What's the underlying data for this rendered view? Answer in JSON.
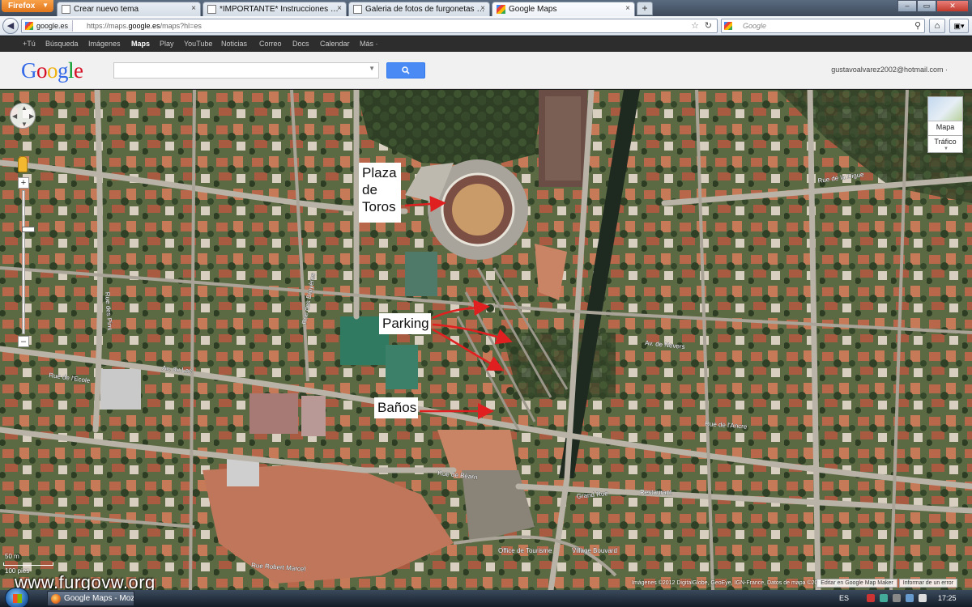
{
  "browser": {
    "menu_label": "Firefox",
    "tabs": [
      {
        "label": "Crear nuevo tema",
        "active": false
      },
      {
        "label": "*IMPORTANTE* Instrucciones para a...",
        "active": false
      },
      {
        "label": "Galeria de fotos de furgonetas campe...",
        "active": false
      },
      {
        "label": "Google Maps",
        "active": true
      }
    ],
    "new_tab": "+",
    "identity": "google.es",
    "url_prefix": "https://maps.",
    "url_domain": "google.es",
    "url_suffix": "/maps?hl=es",
    "search_placeholder": "Google"
  },
  "google_bar": {
    "items": [
      "+Tú",
      "Búsqueda",
      "Imágenes",
      "Maps",
      "Play",
      "YouTube",
      "Noticias",
      "Correo",
      "Docs",
      "Calendar",
      "Más ·"
    ],
    "selected": "Maps"
  },
  "header": {
    "logo_letters": [
      "G",
      "o",
      "o",
      "g",
      "l",
      "e"
    ],
    "search_value": "",
    "search_button_icon": "magnifier-icon",
    "user_email": "gustavoalvarez2002@hotmail.com ·"
  },
  "map": {
    "type_label": "Mapa",
    "traffic_label": "Tráfico",
    "annotations": {
      "plaza": [
        "Plaza",
        "de",
        "Toros"
      ],
      "parking": "Parking",
      "banos": "Baños"
    },
    "annotation_arrow_color": "#e02020",
    "street_labels": [
      "Rue de l'Ecole",
      "Av. du Lac",
      "Rue Robert Marcel",
      "Grand Rue",
      "Rue de l'Ancre",
      "Av. de Nevers",
      "Rue des Bruyères",
      "Rue de la Digue",
      "Rue de Béarn",
      "Rue des Pins"
    ],
    "place_labels": [
      "Restaurant",
      "Office de Tourisme",
      "Village Bouvard"
    ],
    "scale_top": "50 m",
    "scale_bottom": "100 pies",
    "copyright": "Imágenes ©2012 DigitalGlobe, GeoEye, IGN-France, Datos de mapa ©2012 Google -",
    "footer_links": [
      "Editar en Google Map Maker",
      "Informar de un error"
    ],
    "watermark": "www.furgovw.org"
  },
  "taskbar": {
    "window_label": "Google Maps - Mozi...",
    "language": "ES",
    "time": "17:25"
  }
}
